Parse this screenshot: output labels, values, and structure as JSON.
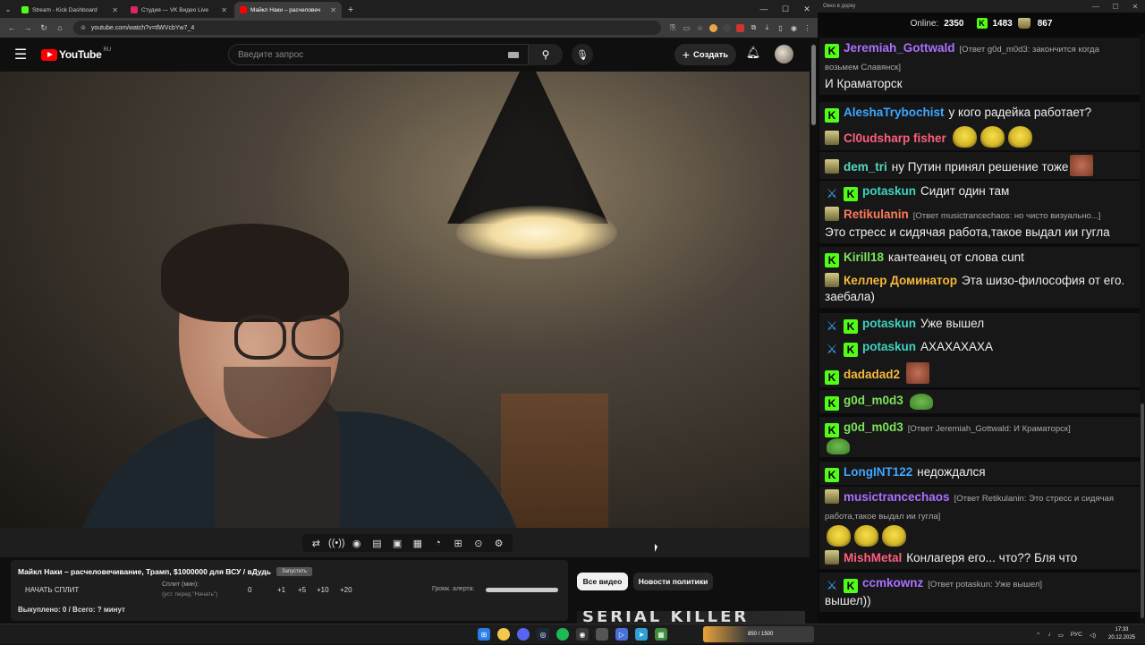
{
  "browser": {
    "tabs": [
      {
        "label": "Stream - Kick Dashboard",
        "color": "#53fc18",
        "active": false
      },
      {
        "label": "Студия — VK Видео Live",
        "color": "#e0245e",
        "active": false
      },
      {
        "label": "Майкл Наки – расчеловеч",
        "color": "#ff0000",
        "active": true
      }
    ],
    "url": "youtube.com/watch?v=tlWVcbYw7_4"
  },
  "youtube": {
    "logo_text": "YouTube",
    "region": "RU",
    "search_placeholder": "Введите запрос",
    "create_label": "Создать"
  },
  "panel": {
    "video_title": "Майкл Наки – расчеловечивание, Трамп, $1000000 для ВСУ / вДудь",
    "tag": "Запустить",
    "split_button": "НАЧАТЬ СПЛИТ",
    "split_label": "Сплит (мин):",
    "split_sub": "(уст. перед \"Начать\")",
    "split_value": "0",
    "increments": [
      "+1",
      "+5",
      "+10",
      "+20"
    ],
    "volume_label": "Громк. алерта:",
    "bought": "Выкуплено: 0 / Всего: ? минут"
  },
  "chips": {
    "all_videos": "Все видео",
    "politics_news": "Новости политики"
  },
  "thumb_peek_text": "SERIAL KILLER",
  "chat_window": {
    "title": "Окно в дорку"
  },
  "chat_stats": {
    "online_label": "Online:",
    "online": "2350",
    "kick_count": "1483",
    "other_count": "867"
  },
  "chat": {
    "messages": [
      {
        "badges": [
          "k"
        ],
        "user": "Jeremiah_Gottwald",
        "color": "#a970ff",
        "reply": "[Ответ g0d_m0d3: закончится когда возьмем Славянск]",
        "text": "И Краматорск",
        "emotes": []
      },
      {
        "badges": [
          "k"
        ],
        "user": "AleshaTrybochist",
        "color": "#3ea6ff",
        "reply": "",
        "text": "у кого радейка работает?",
        "emotes": []
      },
      {
        "badges": [
          "hat"
        ],
        "user": "Cl0udsharp fisher",
        "color": "#ff5e7e",
        "reply": "",
        "text": "",
        "emotes": [
          "yellow",
          "yellow",
          "yellow"
        ]
      },
      {
        "badges": [
          "hat"
        ],
        "user": "dem_tri",
        "color": "#53d9c3",
        "reply": "",
        "text": "ну Путин принял решение тоже",
        "emotes": [
          "face"
        ]
      },
      {
        "badges": [
          "sword",
          "k"
        ],
        "user": "potaskun",
        "color": "#3ed3c0",
        "reply": "",
        "text": "Сидит один там",
        "emotes": []
      },
      {
        "badges": [
          "hat"
        ],
        "user": "Retikulanin",
        "color": "#ff7b5c",
        "reply": "[Ответ musictrancechaos: но чисто визуально...]",
        "text": "Это стресс и сидячая работа,такое выдал ии гугла",
        "emotes": []
      },
      {
        "badges": [
          "k"
        ],
        "user": "Kirill18",
        "color": "#7de35b",
        "reply": "",
        "text": "кантеанец от слова cunt",
        "emotes": []
      },
      {
        "badges": [
          "hat"
        ],
        "user": "Келлер Доминатор",
        "color": "#f6b93b",
        "reply": "",
        "text": "Эта шизо-философия от его. заебала)",
        "emotes": []
      },
      {
        "badges": [
          "sword",
          "k"
        ],
        "user": "potaskun",
        "color": "#3ed3c0",
        "reply": "",
        "text": "Уже вышел",
        "emotes": []
      },
      {
        "badges": [
          "sword",
          "k"
        ],
        "user": "potaskun",
        "color": "#3ed3c0",
        "reply": "",
        "text": "АХАХАХАХА",
        "emotes": []
      },
      {
        "badges": [
          "k"
        ],
        "user": "dadadad2",
        "color": "#f6b93b",
        "reply": "",
        "text": "",
        "emotes": [
          "face"
        ]
      },
      {
        "badges": [
          "k"
        ],
        "user": "g0d_m0d3",
        "color": "#7de35b",
        "reply": "",
        "text": "",
        "emotes": [
          "frog"
        ]
      },
      {
        "badges": [
          "k"
        ],
        "user": "g0d_m0d3",
        "color": "#7de35b",
        "reply": "[Ответ Jeremiah_Gottwald: И Краматорск]",
        "text": "",
        "emotes": [
          "frog"
        ]
      },
      {
        "badges": [
          "k"
        ],
        "user": "LongINT122",
        "color": "#3ea6ff",
        "reply": "",
        "text": "недождался",
        "emotes": []
      },
      {
        "badges": [
          "hat"
        ],
        "user": "musictrancechaos",
        "color": "#a970ff",
        "reply": "[Ответ Retikulanin: Это стресс и сидячая работа,такое выдал ии гугла]",
        "text": "",
        "emotes": [
          "yellow",
          "yellow",
          "yellow"
        ]
      },
      {
        "badges": [
          "hat"
        ],
        "user": "MishMetal",
        "color": "#ff5e7e",
        "reply": "",
        "text": "Конлагеря его... что?? Бля что",
        "emotes": []
      },
      {
        "badges": [
          "sword",
          "k"
        ],
        "user": "ccmkownz",
        "color": "#a970ff",
        "reply": "[Ответ potaskun: Уже вышел]",
        "text": "вышел))",
        "emotes": []
      }
    ]
  },
  "taskbar": {
    "widget_text": "850 / 1500",
    "language": "РУС",
    "time": "17:33",
    "date": "20.12.2025"
  }
}
